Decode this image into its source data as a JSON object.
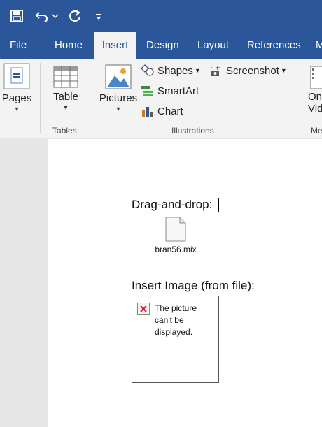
{
  "quick_access": {
    "save_icon": "save-icon",
    "undo_icon": "undo-icon",
    "redo_icon": "redo-icon",
    "customize_icon": "customize-qat-icon"
  },
  "tabs": [
    {
      "label": "File"
    },
    {
      "label": "Home"
    },
    {
      "label": "Insert"
    },
    {
      "label": "Design"
    },
    {
      "label": "Layout"
    },
    {
      "label": "References"
    },
    {
      "label": "M"
    }
  ],
  "ribbon": {
    "pages": {
      "label": "Pages"
    },
    "tables": {
      "table_label": "Table",
      "group_label": "Tables"
    },
    "illustrations": {
      "pictures_label": "Pictures",
      "shapes_label": "Shapes",
      "screenshot_label": "Screenshot",
      "smartart_label": "SmartArt",
      "chart_label": "Chart",
      "group_label": "Illustrations"
    },
    "media": {
      "line1": "On",
      "line2": "Vid",
      "group_label": "Me"
    }
  },
  "document": {
    "heading_drag": "Drag-and-drop:",
    "file_name": "bran56.mix",
    "heading_insert": "Insert Image (from file):",
    "broken_image_text": "The picture can't be displayed."
  },
  "colors": {
    "brand": "#2b579a",
    "ribbon_bg": "#f3f3f3",
    "broken_x": "#e81123"
  }
}
